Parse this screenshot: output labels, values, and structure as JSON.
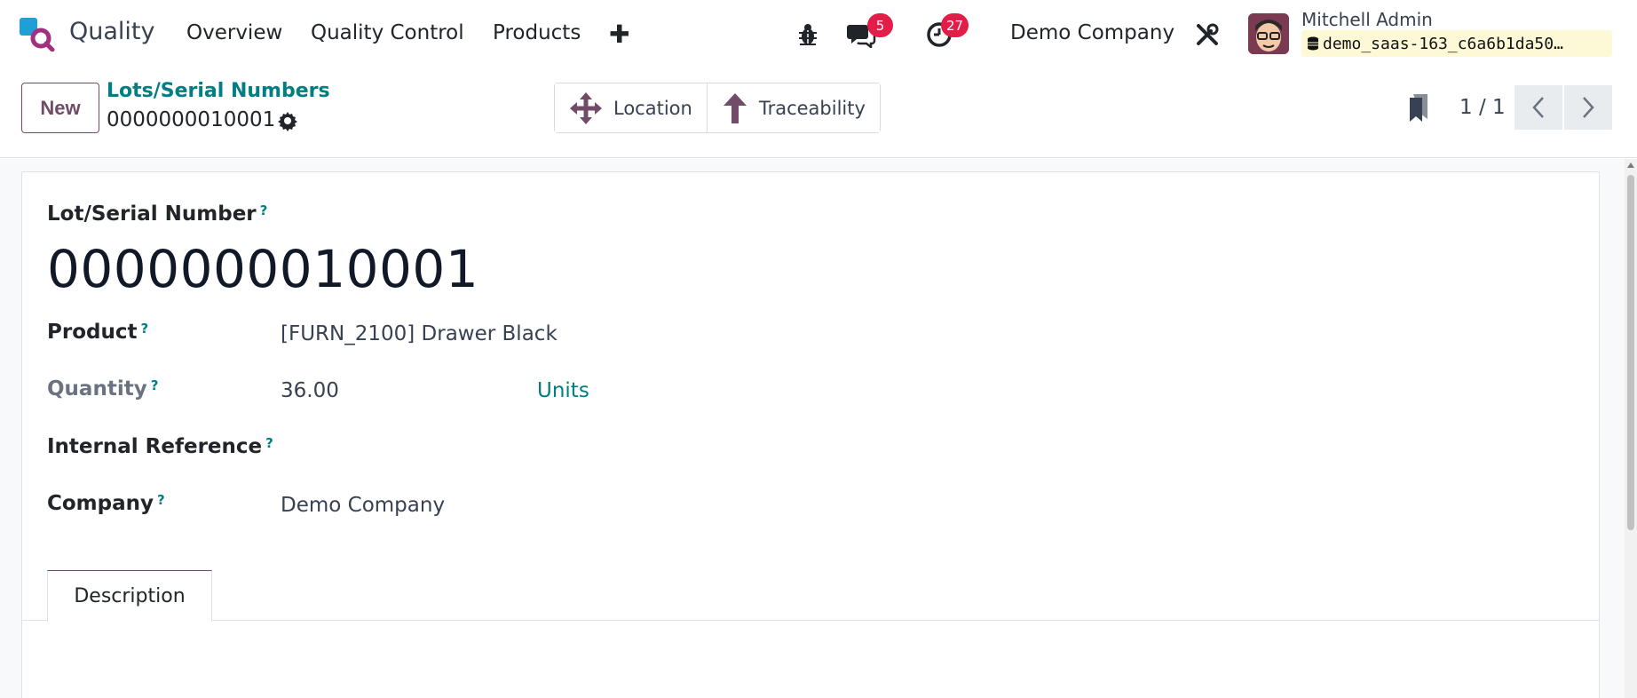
{
  "navbar": {
    "app_name": "Quality",
    "menu": [
      "Overview",
      "Quality Control",
      "Products"
    ],
    "add_icon": "plus-icon",
    "messages_count": "5",
    "activities_count": "27",
    "company": "Demo Company",
    "user_name": "Mitchell Admin",
    "database": "demo_saas-163_c6a6b1da50…"
  },
  "control": {
    "new_label": "New",
    "breadcrumb": "Lots/Serial Numbers",
    "record_name": "0000000010001",
    "smart_buttons": [
      "Location",
      "Traceability"
    ],
    "pager": "1 / 1"
  },
  "form": {
    "lot_label": "Lot/Serial Number",
    "lot_value": "0000000010001",
    "product_label": "Product",
    "product_value": "[FURN_2100] Drawer Black",
    "quantity_label": "Quantity",
    "quantity_value": "36.00",
    "quantity_uom": "Units",
    "internal_ref_label": "Internal Reference",
    "company_label": "Company",
    "company_value": "Demo Company",
    "help_mark": "?"
  },
  "tabs": [
    "Description"
  ],
  "colors": {
    "brand": "#714b67",
    "link": "#017e84",
    "badge": "#e11d48"
  }
}
